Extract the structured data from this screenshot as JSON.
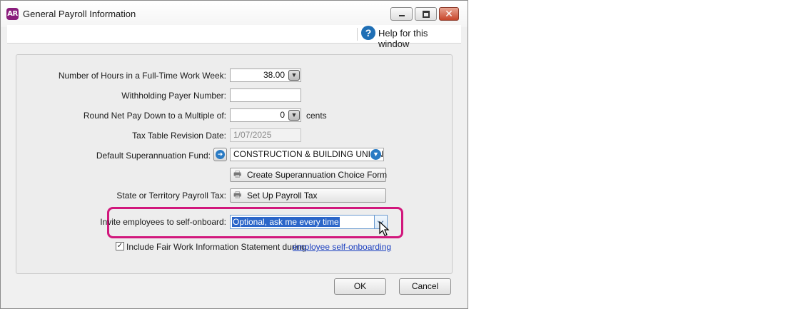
{
  "window": {
    "app_badge": "AR",
    "title": "General Payroll Information",
    "close_glyph": "✕"
  },
  "help": {
    "label": "Help for this window",
    "icon": "?"
  },
  "form": {
    "hours_label": "Number of Hours in a Full-Time Work Week:",
    "hours_value": "38.00",
    "payer_label": "Withholding Payer Number:",
    "payer_value": "",
    "round_label": "Round Net Pay Down to a Multiple of:",
    "round_value": "0",
    "round_unit": "cents",
    "taxdate_label": "Tax Table Revision Date:",
    "taxdate_value": "1/07/2025",
    "super_label": "Default Superannuation Fund:",
    "super_value": "CONSTRUCTION & BUILDING UNIONS S",
    "super_choice_btn": "Create Superannuation Choice Form",
    "payroll_tax_label": "State or Territory Payroll Tax:",
    "payroll_tax_btn": "Set Up Payroll Tax",
    "invite_label": "Invite employees to self-onboard:",
    "invite_value": "Optional, ask me every time",
    "fairwork_label": "Include Fair Work Information Statement during",
    "fairwork_link": "employee self-onboarding"
  },
  "buttons": {
    "ok": "OK",
    "cancel": "Cancel"
  },
  "colors": {
    "highlight": "#d1177c",
    "selection": "#2b66c9",
    "link": "#1a3fbf",
    "badge": "#8a1c7c"
  }
}
